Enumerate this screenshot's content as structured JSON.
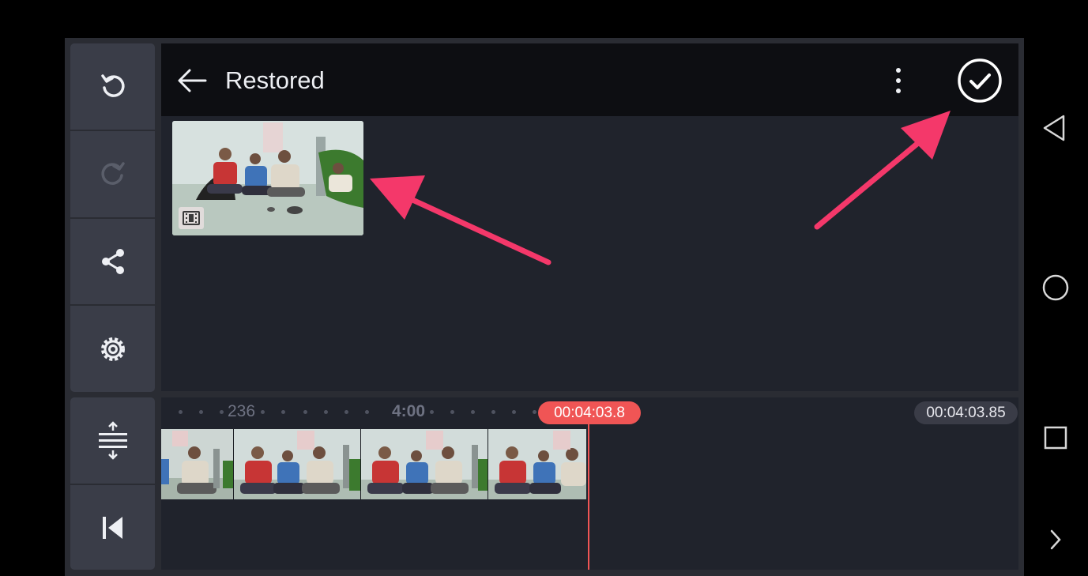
{
  "header": {
    "back_icon": "arrow-left-icon",
    "title": "Restored",
    "more_icon": "more-vert-icon",
    "confirm_icon": "check-circle-icon"
  },
  "sidebar": {
    "items": [
      {
        "name": "undo",
        "icon": "undo-icon"
      },
      {
        "name": "redo",
        "icon": "redo-icon"
      },
      {
        "name": "share",
        "icon": "share-icon"
      },
      {
        "name": "settings",
        "icon": "gear-icon"
      }
    ],
    "bottom_items": [
      {
        "name": "expand-timeline",
        "icon": "expand-icon"
      },
      {
        "name": "skip-to-start",
        "icon": "skip-start-icon"
      }
    ]
  },
  "media": {
    "clip_type_icon": "film-icon"
  },
  "timeline": {
    "ruler_left_label": "236",
    "ruler_mid_label": "4:00",
    "playhead_time": "00:04:03.8",
    "duration": "00:04:03.85"
  },
  "system_nav": {
    "back_icon": "triangle-back-icon",
    "home_icon": "circle-home-icon",
    "recents_icon": "square-recents-icon",
    "more_icon": "chevron-right-icon"
  },
  "colors": {
    "accent": "#f05555",
    "arrow": "#f4386a",
    "panel": "#20232c",
    "sidebar": "#3a3d48"
  }
}
